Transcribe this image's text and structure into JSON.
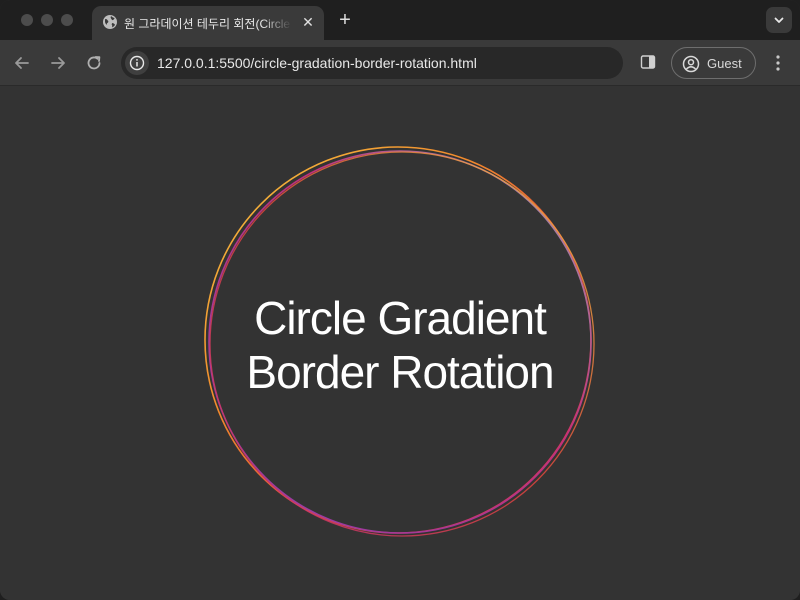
{
  "browser": {
    "tab": {
      "title": "원 그라데이션 테두리 회전(Circle Gradient Border Rotation)",
      "close_glyph": "✕"
    },
    "new_tab_glyph": "+",
    "address_bar": {
      "url": "127.0.0.1:5500/circle-gradation-border-rotation.html"
    },
    "profile": {
      "label": "Guest"
    }
  },
  "page": {
    "heading_line1": "Circle Gradient",
    "heading_line2": "Border Rotation",
    "background": "#333333",
    "text_color": "#ffffff",
    "ring_colors": [
      "#f4c542",
      "#f28b2c",
      "#e0443c",
      "#c2307a",
      "#8e3fb0",
      "#9aa7b8"
    ]
  },
  "icons": {
    "tab_icon": "globe-icon",
    "back": "arrow-left-icon",
    "forward": "arrow-right-icon",
    "reload": "reload-icon",
    "site_info": "info-icon",
    "side_panel": "side-panel-icon",
    "profile": "user-circle-icon",
    "menu": "kebab-menu-icon",
    "tab_search": "chevron-down-icon"
  }
}
